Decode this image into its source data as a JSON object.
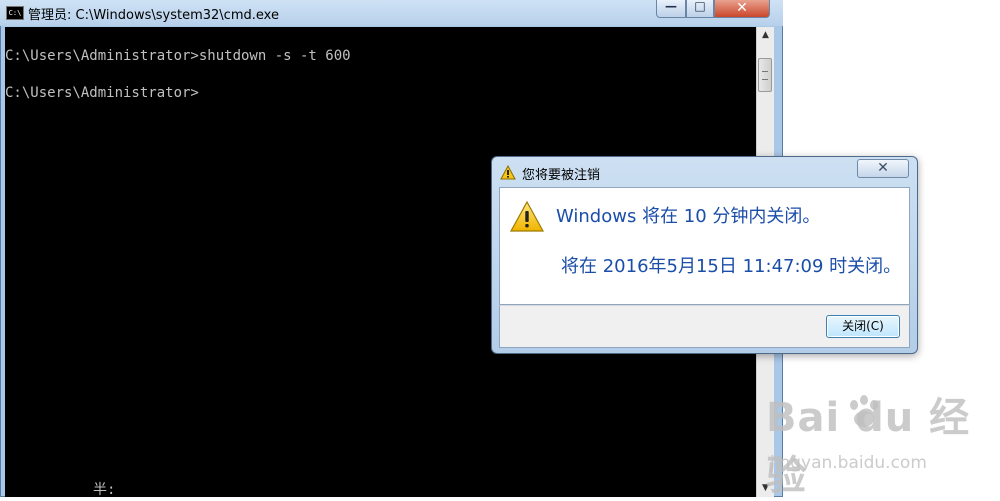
{
  "cmd_window": {
    "title": "管理员: C:\\Windows\\system32\\cmd.exe",
    "icon_label": "C:\\",
    "controls": {
      "minimize": "—",
      "maximize": "□",
      "close": "✕"
    },
    "console_lines": [
      "C:\\Users\\Administrator>shutdown -s -t 600",
      "C:\\Users\\Administrator>"
    ],
    "ime_status": "半:"
  },
  "dialog": {
    "title": "您将要被注销",
    "close_glyph": "✕",
    "message": "Windows 将在 10 分钟内关闭。",
    "detail": "将在 2016年5月15日 11:47:09 时关闭。",
    "close_button_label": "关闭(C)"
  },
  "watermark": {
    "logo_text": "Bai du 经验",
    "url": "jingyan.baidu.com"
  },
  "colors": {
    "dialog_text": "#1a4ea8",
    "console_text": "#c0c0c0",
    "console_bg": "#000000"
  }
}
